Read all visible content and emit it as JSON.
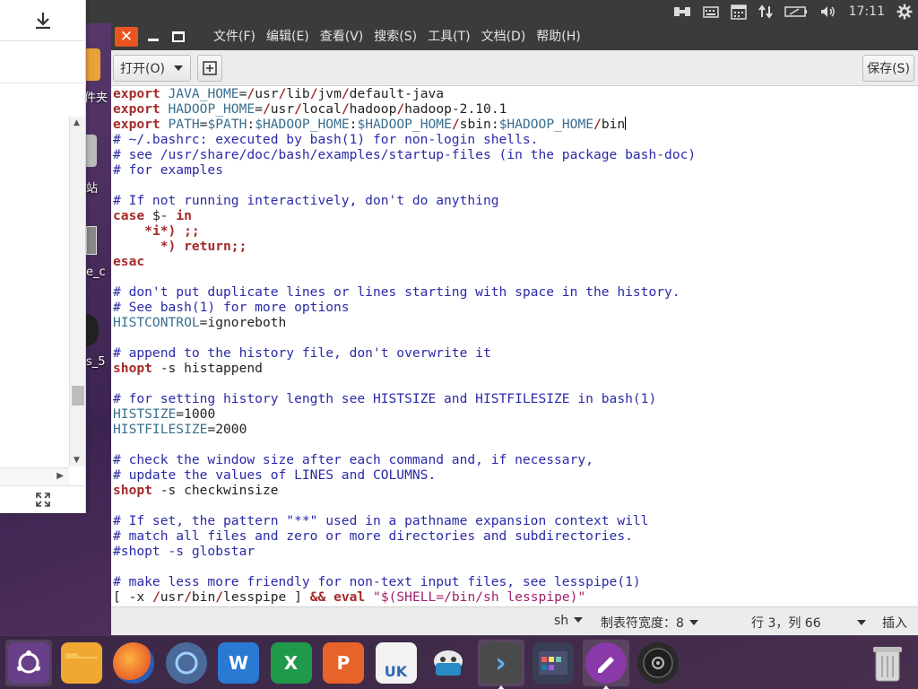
{
  "top_panel": {
    "clock": "17:11",
    "tray_icons": [
      "network-wired-icon",
      "keyboard-icon",
      "calendar-icon",
      "transfer-icon",
      "battery-icon",
      "volume-icon",
      "gear-icon"
    ]
  },
  "desktop": {
    "labels": [
      "件夹",
      "站",
      "e_c",
      "s_5"
    ]
  },
  "editor": {
    "menus": [
      "文件(F)",
      "编辑(E)",
      "查看(V)",
      "搜索(S)",
      "工具(T)",
      "文档(D)",
      "帮助(H)"
    ],
    "toolbar": {
      "open_label": "打开(O)",
      "save_label": "保存(S)"
    },
    "statusbar": {
      "language": "sh",
      "tab_width": "制表符宽度：8",
      "position": "行 3，列 66",
      "insert_mode": "插入"
    },
    "lines": [
      [
        [
          "kw",
          "export"
        ],
        [
          "tx",
          " "
        ],
        [
          "vr",
          "JAVA_HOME"
        ],
        [
          "tx",
          "="
        ],
        [
          "kw",
          "/"
        ],
        [
          "tx",
          "usr"
        ],
        [
          "kw",
          "/"
        ],
        [
          "tx",
          "lib"
        ],
        [
          "kw",
          "/"
        ],
        [
          "tx",
          "jvm"
        ],
        [
          "kw",
          "/"
        ],
        [
          "tx",
          "default-java"
        ]
      ],
      [
        [
          "kw",
          "export"
        ],
        [
          "tx",
          " "
        ],
        [
          "vr",
          "HADOOP_HOME"
        ],
        [
          "tx",
          "="
        ],
        [
          "kw",
          "/"
        ],
        [
          "tx",
          "usr"
        ],
        [
          "kw",
          "/"
        ],
        [
          "tx",
          "local"
        ],
        [
          "kw",
          "/"
        ],
        [
          "tx",
          "hadoop"
        ],
        [
          "kw",
          "/"
        ],
        [
          "tx",
          "hadoop-2.10.1"
        ]
      ],
      [
        [
          "kw",
          "export"
        ],
        [
          "tx",
          " "
        ],
        [
          "vr",
          "PATH"
        ],
        [
          "tx",
          "="
        ],
        [
          "vr",
          "$PATH"
        ],
        [
          "tx",
          ":"
        ],
        [
          "vr",
          "$HADOOP_HOME"
        ],
        [
          "tx",
          ":"
        ],
        [
          "vr",
          "$HADOOP_HOME"
        ],
        [
          "kw",
          "/"
        ],
        [
          "tx",
          "sbin:"
        ],
        [
          "vr",
          "$HADOOP_HOME"
        ],
        [
          "kw",
          "/"
        ],
        [
          "tx",
          "bin"
        ],
        [
          "cursor",
          ""
        ]
      ],
      [
        [
          "cm",
          "# ~/.bashrc: executed by bash(1) for non-login shells."
        ]
      ],
      [
        [
          "cm",
          "# see /usr/share/doc/bash/examples/startup-files (in the package bash-doc)"
        ]
      ],
      [
        [
          "cm",
          "# for examples"
        ]
      ],
      [
        [
          "tx",
          ""
        ]
      ],
      [
        [
          "cm",
          "# If not running interactively, don't do anything"
        ]
      ],
      [
        [
          "kw",
          "case"
        ],
        [
          "tx",
          " $- "
        ],
        [
          "kw",
          "in"
        ]
      ],
      [
        [
          "tx",
          "    "
        ],
        [
          "kw",
          "*i*)"
        ],
        [
          "tx",
          " "
        ],
        [
          "kw",
          ";;"
        ]
      ],
      [
        [
          "tx",
          "      "
        ],
        [
          "kw",
          "*)"
        ],
        [
          "tx",
          " "
        ],
        [
          "kw",
          "return;;"
        ]
      ],
      [
        [
          "kw",
          "esac"
        ]
      ],
      [
        [
          "tx",
          ""
        ]
      ],
      [
        [
          "cm",
          "# don't put duplicate lines or lines starting with space in the history."
        ]
      ],
      [
        [
          "cm",
          "# See bash(1) for more options"
        ]
      ],
      [
        [
          "vr",
          "HISTCONTROL"
        ],
        [
          "tx",
          "=ignoreboth"
        ]
      ],
      [
        [
          "tx",
          ""
        ]
      ],
      [
        [
          "cm",
          "# append to the history file, don't overwrite it"
        ]
      ],
      [
        [
          "kw",
          "shopt"
        ],
        [
          "tx",
          " -s histappend"
        ]
      ],
      [
        [
          "tx",
          ""
        ]
      ],
      [
        [
          "cm",
          "# for setting history length see HISTSIZE and HISTFILESIZE in bash(1)"
        ]
      ],
      [
        [
          "vr",
          "HISTSIZE"
        ],
        [
          "tx",
          "=1000"
        ]
      ],
      [
        [
          "vr",
          "HISTFILESIZE"
        ],
        [
          "tx",
          "=2000"
        ]
      ],
      [
        [
          "tx",
          ""
        ]
      ],
      [
        [
          "cm",
          "# check the window size after each command and, if necessary,"
        ]
      ],
      [
        [
          "cm",
          "# update the values of LINES and COLUMNS."
        ]
      ],
      [
        [
          "kw",
          "shopt"
        ],
        [
          "tx",
          " -s checkwinsize"
        ]
      ],
      [
        [
          "tx",
          ""
        ]
      ],
      [
        [
          "cm",
          "# If set, the pattern \"**\" used in a pathname expansion context will"
        ]
      ],
      [
        [
          "cm",
          "# match all files and zero or more directories and subdirectories."
        ]
      ],
      [
        [
          "cm",
          "#shopt -s globstar"
        ]
      ],
      [
        [
          "tx",
          ""
        ]
      ],
      [
        [
          "cm",
          "# make less more friendly for non-text input files, see lesspipe(1)"
        ]
      ],
      [
        [
          "tx",
          "[ -x "
        ],
        [
          "kw",
          "/"
        ],
        [
          "tx",
          "usr"
        ],
        [
          "kw",
          "/"
        ],
        [
          "tx",
          "bin"
        ],
        [
          "kw",
          "/"
        ],
        [
          "tx",
          "lesspipe ] "
        ],
        [
          "kw",
          "&&"
        ],
        [
          "tx",
          " "
        ],
        [
          "kw",
          "eval"
        ],
        [
          "tx",
          " "
        ],
        [
          "str",
          "\"$(SHELL=/bin/sh lesspipe)\""
        ]
      ]
    ]
  },
  "dock": {
    "items": [
      {
        "name": "ubuntu-logo-icon",
        "color": "#6a3f8a"
      },
      {
        "name": "files-icon",
        "color": "#f0a830"
      },
      {
        "name": "firefox-icon",
        "color": "#e8632a"
      },
      {
        "name": "browser-icon",
        "color": "#4a6a9a"
      },
      {
        "name": "wps-writer-icon",
        "color": "#2a7ad4",
        "glyph": "W"
      },
      {
        "name": "wps-spreadsheet-icon",
        "color": "#1e9a4a",
        "glyph": "X"
      },
      {
        "name": "wps-presentation-icon",
        "color": "#e8632a",
        "glyph": "P"
      },
      {
        "name": "software-center-icon",
        "color": "#f2f2f2",
        "glyph": "UK"
      },
      {
        "name": "package-icon",
        "color": "#2a8ac4"
      },
      {
        "name": "terminal-icon",
        "color": "#4a4a4a",
        "glyph": "›"
      },
      {
        "name": "app-grid-icon",
        "color": "#3a3f58"
      },
      {
        "name": "text-editor-icon",
        "color": "#8a3aa8"
      },
      {
        "name": "disk-icon",
        "color": "#2a2a2a"
      }
    ],
    "trash": "trash-icon"
  }
}
